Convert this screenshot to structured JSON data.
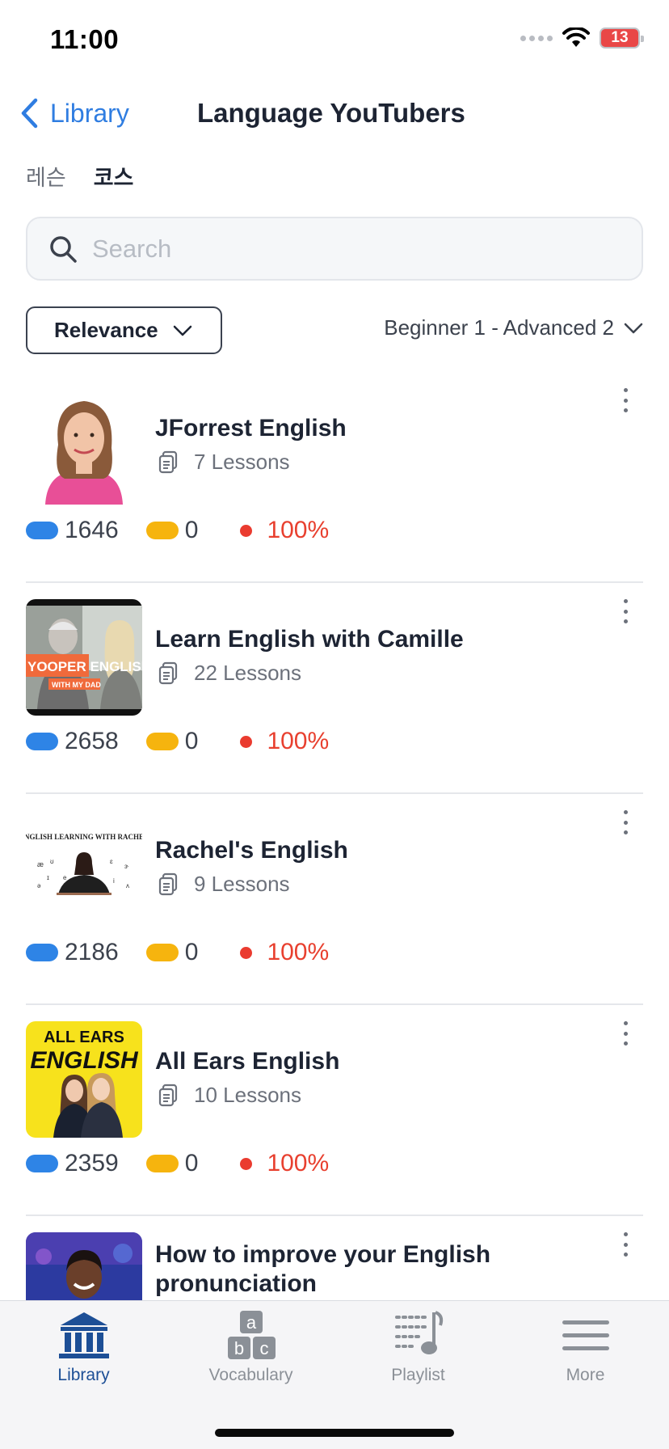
{
  "status_bar": {
    "time": "11:00",
    "battery": "13"
  },
  "header": {
    "back_label": "Library",
    "title": "Language YouTubers"
  },
  "segments": [
    {
      "label": "레슨",
      "active": false
    },
    {
      "label": "코스",
      "active": true
    }
  ],
  "search": {
    "placeholder": "Search",
    "value": ""
  },
  "filters": {
    "sort_label": "Relevance",
    "level_label": "Beginner 1 - Advanced 2"
  },
  "courses": [
    {
      "title": "JForrest English",
      "lessons": "7 Lessons",
      "blue_count": "1646",
      "yellow_count": "0",
      "percent": "100%"
    },
    {
      "title": "Learn English with Camille",
      "lessons": "22 Lessons",
      "blue_count": "2658",
      "yellow_count": "0",
      "percent": "100%"
    },
    {
      "title": "Rachel's English",
      "lessons": "9 Lessons",
      "blue_count": "2186",
      "yellow_count": "0",
      "percent": "100%"
    },
    {
      "title": "All Ears English",
      "lessons": "10 Lessons",
      "blue_count": "2359",
      "yellow_count": "0",
      "percent": "100%"
    },
    {
      "title": "How to improve your English pronunciation"
    }
  ],
  "thumbnails": {
    "camille_text": "YOOPER ENGLISH",
    "camille_sub": "WITH MY DAD",
    "rachel_text": "ENGLISH LEARNING WITH RACHEL",
    "allears_line1": "ALL EARS",
    "allears_line2": "ENGLISH"
  },
  "tab_bar": [
    {
      "label": "Library",
      "icon": "library-icon",
      "active": true
    },
    {
      "label": "Vocabulary",
      "icon": "vocabulary-icon",
      "active": false
    },
    {
      "label": "Playlist",
      "icon": "playlist-icon",
      "active": false
    },
    {
      "label": "More",
      "icon": "more-menu-icon",
      "active": false
    }
  ],
  "colors": {
    "accent": "#2f7de1",
    "active_tab": "#1d4f96",
    "known_words": "#2e84e6",
    "lingqs": "#f6b40e",
    "progress": "#e8402f"
  }
}
